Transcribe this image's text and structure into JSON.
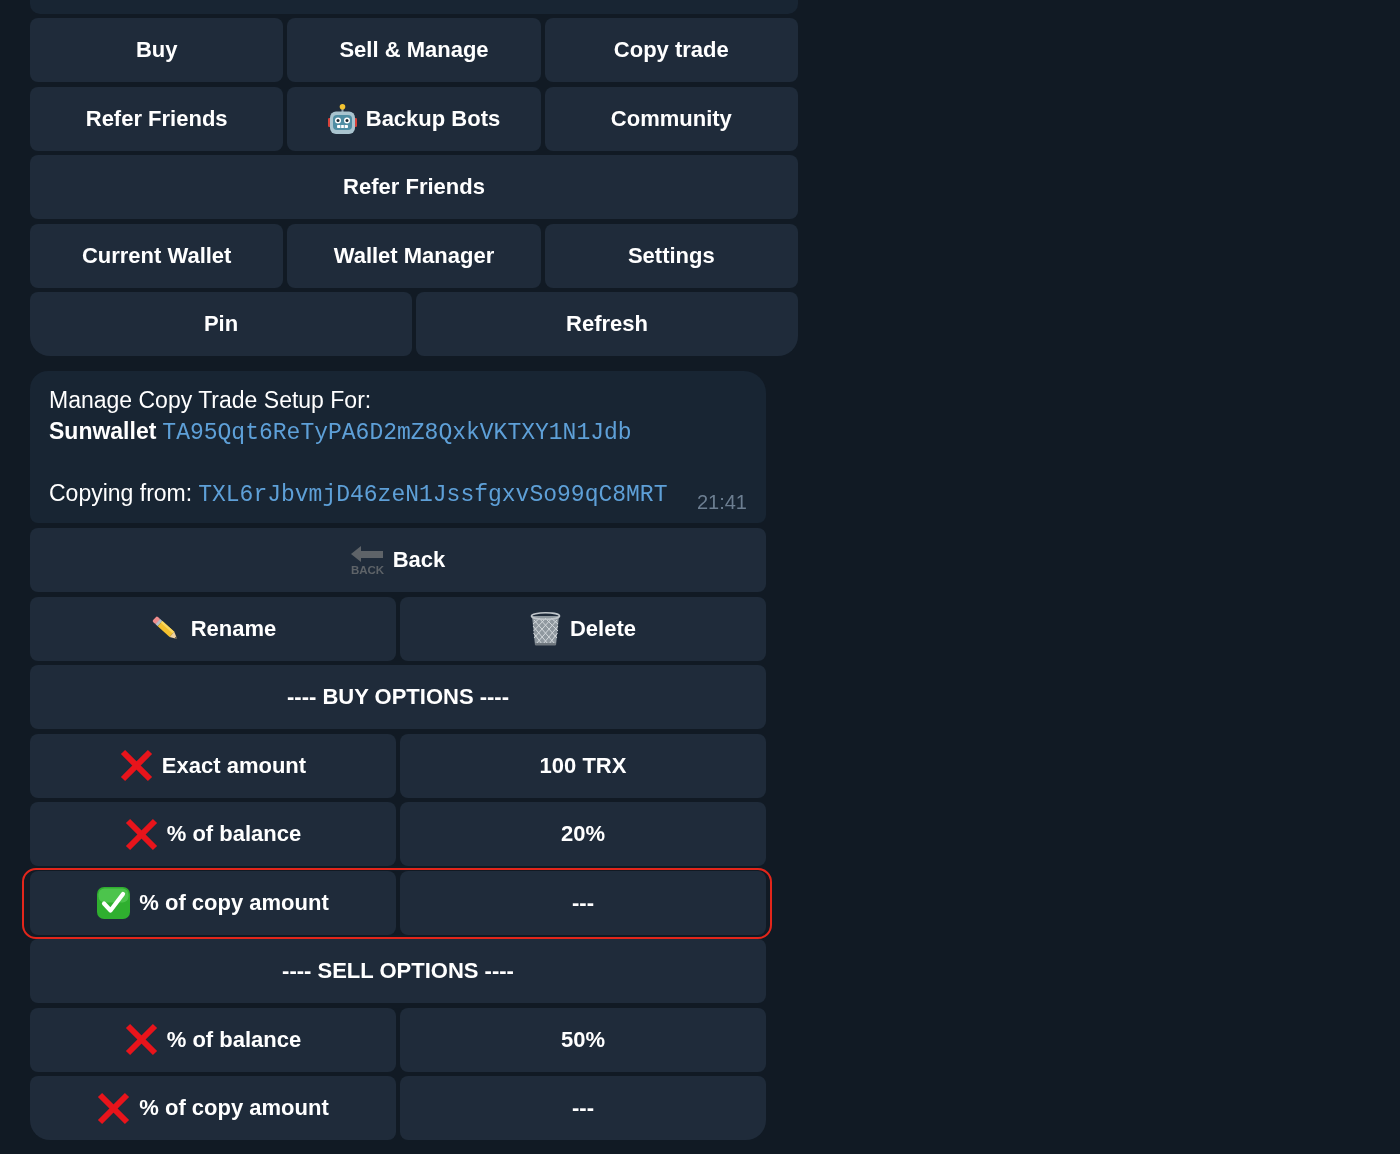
{
  "main_keyboard": {
    "rows": [
      {
        "buttons": [
          {
            "label": "Buy",
            "kind": "plain"
          },
          {
            "label": "Sell & Manage",
            "kind": "plain"
          },
          {
            "label": "Copy trade",
            "kind": "plain"
          }
        ]
      },
      {
        "buttons": [
          {
            "label": "Refer Friends",
            "kind": "plain"
          },
          {
            "label": "Backup Bots",
            "kind": "robot"
          },
          {
            "label": "Community",
            "kind": "plain"
          }
        ]
      },
      {
        "buttons": [
          {
            "label": "Refer Friends",
            "kind": "plain"
          }
        ]
      },
      {
        "buttons": [
          {
            "label": "Current Wallet",
            "kind": "plain"
          },
          {
            "label": "Wallet Manager",
            "kind": "plain"
          },
          {
            "label": "Settings",
            "kind": "plain"
          }
        ]
      },
      {
        "buttons": [
          {
            "label": "Pin",
            "kind": "plain"
          },
          {
            "label": "Refresh",
            "kind": "plain"
          }
        ]
      }
    ]
  },
  "message": {
    "title": "Manage Copy Trade Setup For:",
    "wallet_name": "Sunwallet",
    "wallet_address": "TA95Qqt6ReTyPA6D2mZ8QxkVKTXY1N1Jdb",
    "copying_label": "Copying from:",
    "copying_address": "TXL6rJbvmjD46zeN1JssfgxvSo99qC8MRT",
    "time": "21:41"
  },
  "setup_keyboard": {
    "back_button": {
      "label": "Back",
      "icon_text": "BACK"
    },
    "edit_buttons": [
      {
        "label": "Rename",
        "kind": "rename"
      },
      {
        "label": "Delete",
        "kind": "delete"
      }
    ],
    "sections": [
      {
        "header": "---- BUY OPTIONS ----",
        "options": [
          {
            "label": "Exact amount",
            "checked": false,
            "value": "100 TRX",
            "highlighted": false
          },
          {
            "label": "% of balance",
            "checked": false,
            "value": "20%",
            "highlighted": false
          },
          {
            "label": "% of copy amount",
            "checked": true,
            "value": "---",
            "highlighted": true
          }
        ]
      },
      {
        "header": "---- SELL OPTIONS ----",
        "options": [
          {
            "label": "% of balance",
            "checked": false,
            "value": "50%",
            "highlighted": false
          },
          {
            "label": "% of copy amount",
            "checked": false,
            "value": "---",
            "highlighted": false
          }
        ]
      }
    ]
  }
}
